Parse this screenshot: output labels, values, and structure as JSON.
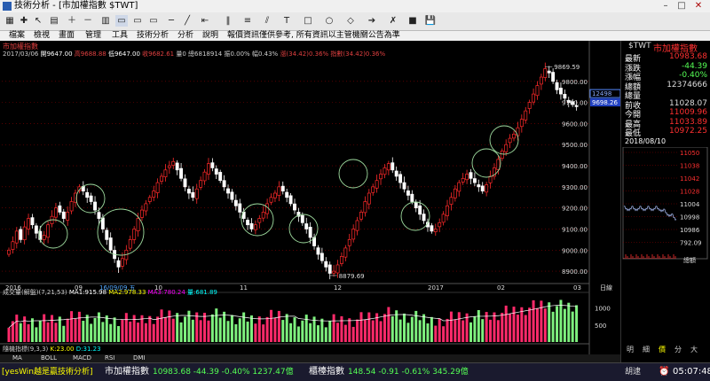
{
  "window": {
    "title": "技術分析 - [市加權指數 $TWT]"
  },
  "menu": [
    "檔案",
    "檢視",
    "畫面",
    "管理",
    "工具",
    "技術分析",
    "分析",
    "說明",
    "報價資訊僅供參考, 所有資訊以主管機關公告為準"
  ],
  "chart": {
    "name": "市加權指數",
    "info_date": "2017/03/06",
    "info_open": "開9647.00",
    "info_high": "高9688.88",
    "info_low": "低9647.00",
    "info_close": "收9682.61",
    "info_vol": "量0",
    "info_amount": "總6818914",
    "info_pct1": "振0.00%",
    "info_pct2": "幅0.43%",
    "info_ma": "漲(34.42)0.36%",
    "info_idx": "指數(34.42)0.36%",
    "y_ticks": [
      "9800.00",
      "9700.00",
      "9600.00",
      "9500.00",
      "9400.00",
      "9300.00",
      "9200.00",
      "9100.00",
      "9000.00",
      "8900.00"
    ],
    "x_ticks": [
      "2016",
      "09",
      "16/09/09,五",
      "10",
      "11",
      "12",
      "2017",
      "02",
      "03"
    ],
    "x_axis_label": "日線",
    "hi_label": "9869.59",
    "lo_label": "8879.69",
    "cur_badge": "12498",
    "cur_price": "9698.26",
    "vol_title": "成交量(解盤)(7,21,53)",
    "vol_ma1": "MA1:915.98",
    "vol_ma2": "MA2:978.33",
    "vol_ma3": "MA3:780.24",
    "vol_amt": "量:681.89",
    "vol_ticks": [
      "1000",
      "500"
    ],
    "sto_title": "隨機指標(9,3,3)",
    "sto_k": "K:23.00",
    "sto_d": "D:31.23",
    "tabs": [
      "MA",
      "BOLL",
      "MACD",
      "RSI",
      "DMI"
    ]
  },
  "quote": {
    "symbol": "$TWT",
    "name": "市加權指數",
    "rows": [
      {
        "label": "最新",
        "value": "10983.68"
      },
      {
        "label": "漲跌",
        "value": "-44.39"
      },
      {
        "label": "漲幅",
        "value": "-0.40%"
      },
      {
        "label": "總額",
        "value": "12374666"
      },
      {
        "label": "總量",
        "value": ""
      },
      {
        "label": "前收",
        "value": "11028.07"
      },
      {
        "label": "今開",
        "value": "11009.96"
      },
      {
        "label": "最高",
        "value": "11033.89"
      },
      {
        "label": "最低",
        "value": "10972.25"
      }
    ],
    "date": "2018/08/10",
    "mini_ticks": [
      "11050",
      "11038",
      "11042",
      "11028",
      "11004",
      "10998",
      "10986",
      "792.09"
    ],
    "mini_vol_label": "總額",
    "mini_tabs": [
      "明",
      "細",
      "價",
      "分",
      "大"
    ]
  },
  "status": {
    "brand": "[yesWin越是贏技術分析]",
    "idx1_name": "市加權指數",
    "idx1_value": "10983.68 -44.39 -0.40% 1237.47億",
    "idx2_name": "櫃檯指數",
    "idx2_value": "148.54 -0.91 -0.61% 345.29億",
    "user": "胡逮",
    "time": "05:07:48"
  },
  "chart_data": {
    "type": "candlestick",
    "ylim": [
      8850,
      9900
    ],
    "y_ticks": [
      8900,
      9000,
      9100,
      9200,
      9300,
      9400,
      9500,
      9600,
      9700,
      9800
    ],
    "high_point": 9869.59,
    "low_point": 8879.69,
    "close_series": [
      9000,
      9040,
      9090,
      9050,
      9110,
      9150,
      9120,
      9080,
      9050,
      9070,
      9120,
      9160,
      9200,
      9180,
      9150,
      9180,
      9230,
      9270,
      9300,
      9280,
      9250,
      9230,
      9190,
      9150,
      9100,
      9050,
      9000,
      8960,
      8920,
      8960,
      9000,
      9050,
      9100,
      9150,
      9190,
      9220,
      9250,
      9280,
      9320,
      9350,
      9380,
      9400,
      9420,
      9380,
      9340,
      9300,
      9270,
      9250,
      9290,
      9330,
      9370,
      9410,
      9390,
      9360,
      9330,
      9300,
      9270,
      9240,
      9210,
      9180,
      9150,
      9120,
      9100,
      9120,
      9150,
      9180,
      9220,
      9250,
      9270,
      9300,
      9280,
      9250,
      9220,
      9190,
      9160,
      9130,
      9100,
      9060,
      9020,
      8980,
      8950,
      8920,
      8890,
      8900,
      8930,
      8970,
      9010,
      9050,
      9100,
      9140,
      9180,
      9230,
      9270,
      9300,
      9330,
      9360,
      9390,
      9410,
      9380,
      9350,
      9320,
      9290,
      9260,
      9230,
      9200,
      9170,
      9140,
      9110,
      9090,
      9100,
      9130,
      9170,
      9210,
      9250,
      9290,
      9320,
      9340,
      9360,
      9340,
      9320,
      9300,
      9280,
      9310,
      9350,
      9390,
      9430,
      9470,
      9500,
      9530,
      9550,
      9580,
      9620,
      9660,
      9700,
      9740,
      9780,
      9820,
      9860,
      9840,
      9800,
      9760,
      9740,
      9720,
      9700,
      9690,
      9680
    ]
  }
}
